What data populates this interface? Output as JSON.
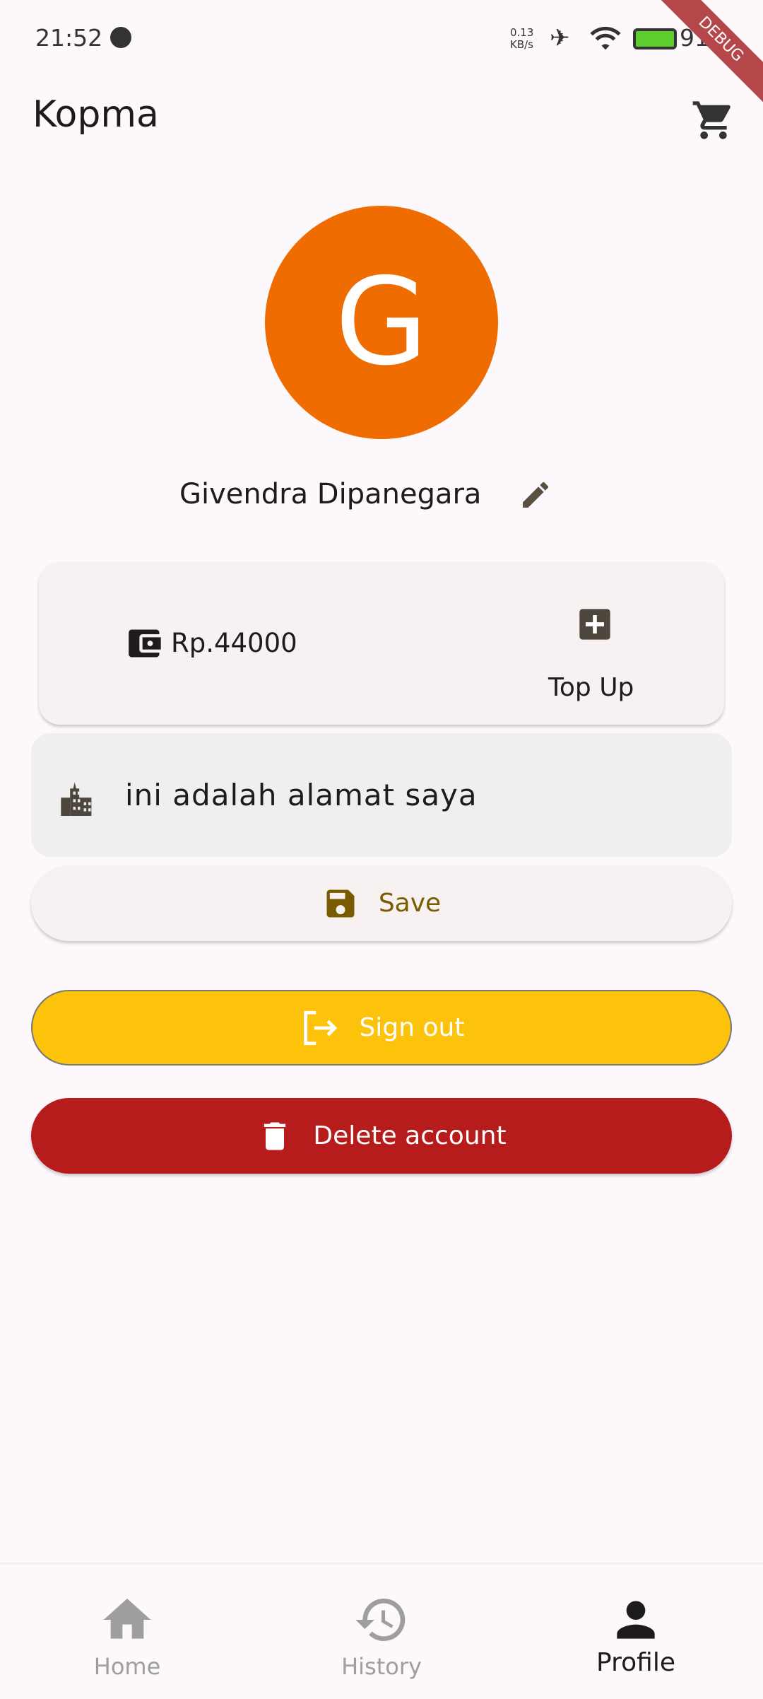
{
  "status_bar": {
    "time": "21:52",
    "net_speed_value": "0.13",
    "net_speed_unit": "KB/s",
    "battery": "91%",
    "debug_banner": "DEBUG"
  },
  "app_bar": {
    "title": "Kopma"
  },
  "profile": {
    "avatar_letter": "G",
    "avatar_color": "#ef6c00",
    "name": "Givendra Dipanegara"
  },
  "wallet": {
    "balance": "Rp.44000",
    "top_up_label": "Top Up"
  },
  "address": {
    "value": "ini adalah alamat saya"
  },
  "buttons": {
    "save": "Save",
    "sign_out": "Sign out",
    "delete": "Delete account"
  },
  "nav": {
    "items": [
      {
        "label": "Home",
        "icon": "home-icon"
      },
      {
        "label": "History",
        "icon": "history-icon"
      },
      {
        "label": "Profile",
        "icon": "person-icon"
      }
    ],
    "active": "Profile"
  }
}
